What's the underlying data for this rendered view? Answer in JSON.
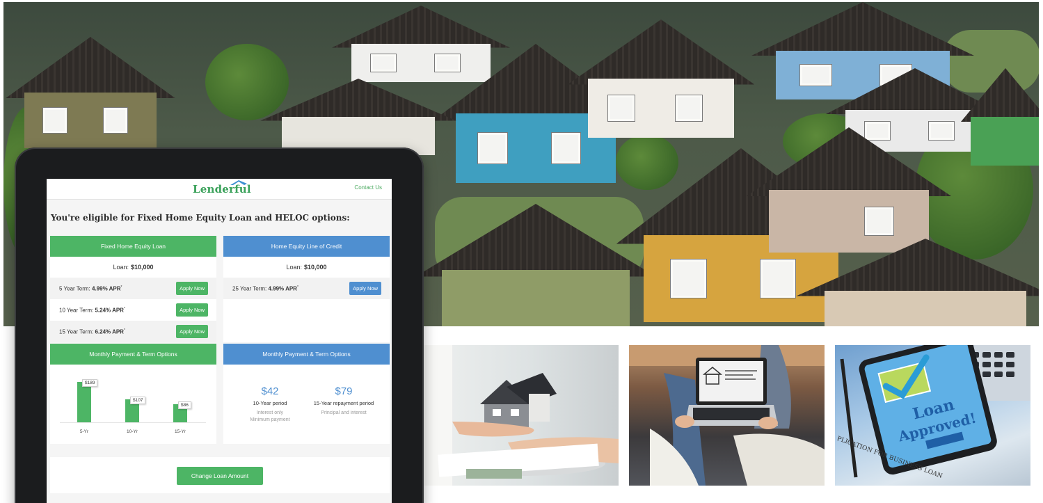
{
  "brand": {
    "name": "Lenderful",
    "accent": "#4db565",
    "secondary": "#4f8fd0"
  },
  "nav": {
    "contact": "Contact Us"
  },
  "heading": "You're eligible for Fixed Home Equity Loan and HELOC options:",
  "fixed_loan": {
    "title": "Fixed Home Equity Loan",
    "loan_label": "Loan:",
    "loan_amount": "$10,000",
    "terms": [
      {
        "label": "5 Year Term:",
        "rate": "4.99% APR",
        "mark": "*",
        "button": "Apply Now"
      },
      {
        "label": "10 Year Term:",
        "rate": "5.24% APR",
        "mark": "*",
        "button": "Apply Now"
      },
      {
        "label": "15 Year Term:",
        "rate": "6.24% APR",
        "mark": "*",
        "button": "Apply Now"
      }
    ]
  },
  "heloc": {
    "title": "Home Equity Line of Credit",
    "loan_label": "Loan:",
    "loan_amount": "$10,000",
    "terms": [
      {
        "label": "25 Year Term:",
        "rate": "4.99% APR",
        "mark": "*",
        "button": "Apply Now"
      }
    ]
  },
  "fixed_payments": {
    "title": "Monthly Payment & Term Options",
    "bars": [
      {
        "label": "5-Yr",
        "value": 189,
        "display": "$189"
      },
      {
        "label": "10-Yr",
        "value": 107,
        "display": "$107"
      },
      {
        "label": "15-Yr",
        "value": 86,
        "display": "$86"
      }
    ]
  },
  "heloc_payments": {
    "title": "Monthly Payment & Term Options",
    "options": [
      {
        "amount": "$42",
        "period": "10-Year period",
        "note1": "Interest only",
        "note2": "Minimum payment"
      },
      {
        "amount": "$79",
        "period": "15-Year repayment period",
        "note1": "Principal and interest",
        "note2": ""
      }
    ]
  },
  "change_button": "Change Loan Amount",
  "images": {
    "hero": "aerial-neighborhood-houses",
    "photo1": "hand-holding-house-model",
    "photo2": "couple-with-laptop",
    "photo3": "phone-loan-approved",
    "photo3_text": "Loan Approved!"
  }
}
